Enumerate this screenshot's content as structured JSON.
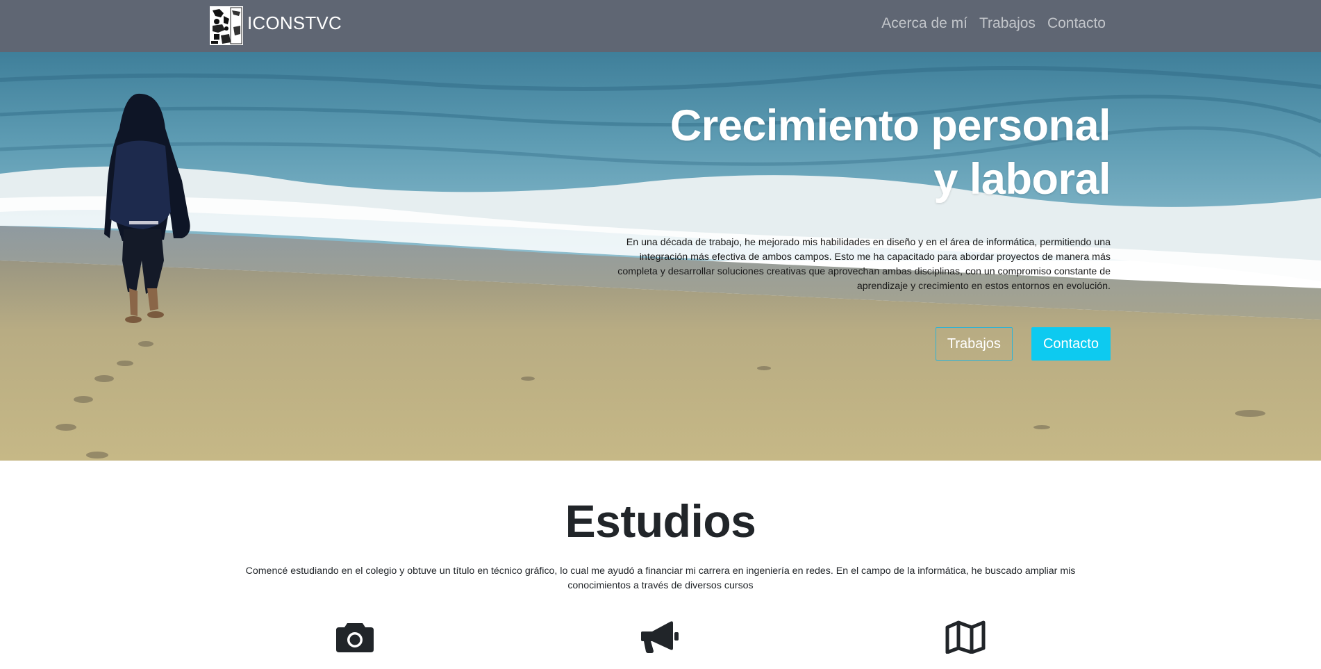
{
  "navbar": {
    "brand_text": "ICONSTVC",
    "logo_icon": "brand-logo-icon",
    "links": [
      "Acerca de mí",
      "Trabajos",
      "Contacto"
    ],
    "background": "#5f6673"
  },
  "hero": {
    "title_line1": "Crecimiento personal",
    "title_line2": "y laboral",
    "text_line1": "En una década de trabajo, he mejorado mis habilidades en diseño y en el área de informática, permitiendo una",
    "text_line2": "integración más efectiva de ambos campos. Esto me ha capacitado para abordar proyectos de manera más",
    "text_line3": "completa y desarrollar soluciones creativas que aprovechan ambas disciplinas, con un compromiso constante de",
    "text_line4": "aprendizaje y crecimiento en estos entornos en evolución.",
    "buttons": {
      "primary_label": "Trabajos",
      "secondary_label": "Contacto"
    },
    "accent_color": "#0dcaf0"
  },
  "studies": {
    "title": "Estudios",
    "text_line1": "Comencé estudiando en el colegio y obtuve un título en técnico gráfico, lo cual me ayudó a financiar mi carrera en ingeniería en redes. En el campo de la informática, he buscado ampliar mis",
    "text_line2": "conocimientos a través de diversos cursos",
    "icons": [
      "camera-icon",
      "megaphone-icon",
      "map-icon"
    ]
  }
}
